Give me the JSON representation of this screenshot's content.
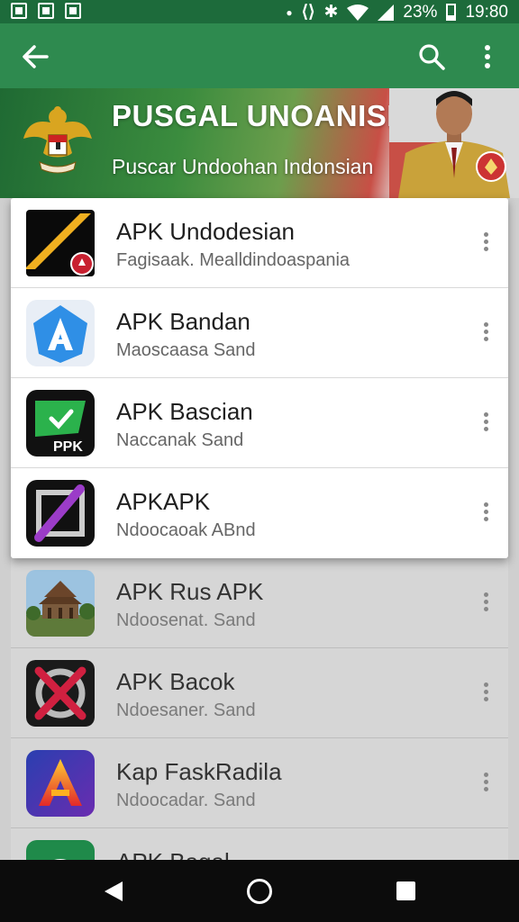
{
  "status_bar": {
    "battery": "23%",
    "time": "19:80"
  },
  "app_bar": {
    "back_icon": "arrow-left-icon",
    "search_icon": "search-icon",
    "more_icon": "more-vert-icon"
  },
  "banner": {
    "title": "PUSGAL UNOANISII",
    "subtitle": "Puscar Undoohan Indonsian"
  },
  "apps_front": [
    {
      "name": "APK Undodesian",
      "desc": "Fagisaak. Mealldindoaspania",
      "icon": "stripe-icon"
    },
    {
      "name": "APK Bandan",
      "desc": "Maoscaasa Sand",
      "icon": "letter-a-blue-icon"
    },
    {
      "name": "APK Bascian",
      "desc": "Naccanak Sand",
      "icon": "green-check-ppk-icon"
    },
    {
      "name": "APKAPK",
      "desc": "Ndoocaoak ABnd",
      "icon": "purple-slash-icon"
    }
  ],
  "apps_back": [
    {
      "name": "APK Rus APK",
      "desc": "Ndoosenat. Sand",
      "icon": "temple-photo-icon"
    },
    {
      "name": "APK Bacok",
      "desc": "Ndoesaner. Sand",
      "icon": "red-x-icon"
    },
    {
      "name": "Kap FaskRadila",
      "desc": "Ndoocadar. Sand",
      "icon": "letter-a-gradient-icon"
    },
    {
      "name": "APK Bagal",
      "desc": "",
      "icon": "green-arc-icon"
    }
  ],
  "colors": {
    "status_bar": "#1d6b3b",
    "app_bar": "#2e8a4f",
    "nav_bar": "#0c0c0c"
  }
}
